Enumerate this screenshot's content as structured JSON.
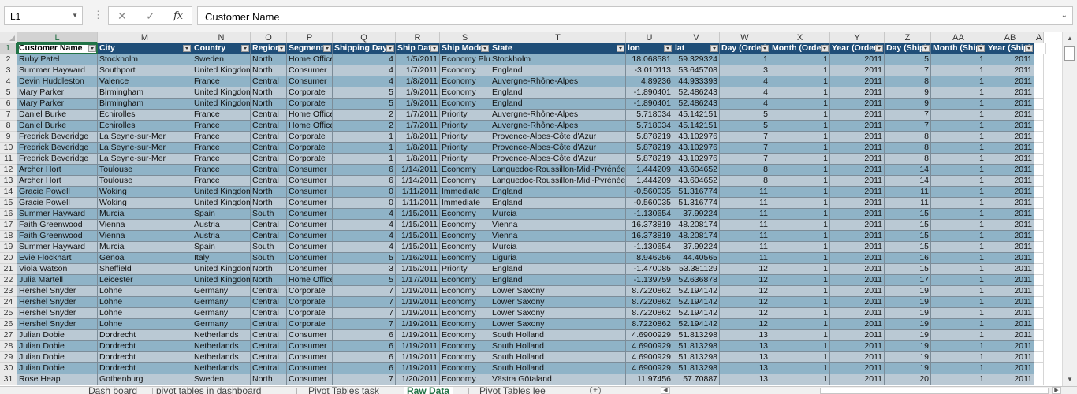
{
  "formula_bar": {
    "name_box": "L1",
    "cancel_icon": "✕",
    "confirm_icon": "✓",
    "fx_label": "fx",
    "content": "Customer Name"
  },
  "columns": [
    "L",
    "M",
    "N",
    "O",
    "P",
    "Q",
    "R",
    "S",
    "T",
    "U",
    "V",
    "W",
    "X",
    "Y",
    "Z",
    "AA",
    "AB",
    "A"
  ],
  "headers": [
    "Customer Name",
    "City",
    "Country",
    "Region",
    "Segment",
    "Shipping Days",
    "Ship Date",
    "Ship Mode",
    "State",
    "lon",
    "lat",
    "Day (Order)",
    "Month (Order)",
    "Year (Order)",
    "Day (Ship)",
    "Month (Ship)",
    "Year (Ship)"
  ],
  "rows": [
    {
      "n": "2",
      "c": [
        "Ruby Patel",
        "Stockholm",
        "Sweden",
        "North",
        "Home Office",
        "4",
        "1/5/2011",
        "Economy Plus",
        "Stockholm",
        "18.068581",
        "59.329324",
        "1",
        "1",
        "2011",
        "5",
        "1",
        "2011"
      ]
    },
    {
      "n": "3",
      "c": [
        "Summer Hayward",
        "Southport",
        "United Kingdom",
        "North",
        "Consumer",
        "4",
        "1/7/2011",
        "Economy",
        "England",
        "-3.010113",
        "53.645708",
        "3",
        "1",
        "2011",
        "7",
        "1",
        "2011"
      ]
    },
    {
      "n": "4",
      "c": [
        "Devin Huddleston",
        "Valence",
        "France",
        "Central",
        "Consumer",
        "4",
        "1/8/2011",
        "Economy",
        "Auvergne-Rhône-Alpes",
        "4.89236",
        "44.933393",
        "4",
        "1",
        "2011",
        "8",
        "1",
        "2011"
      ]
    },
    {
      "n": "5",
      "c": [
        "Mary Parker",
        "Birmingham",
        "United Kingdom",
        "North",
        "Corporate",
        "5",
        "1/9/2011",
        "Economy",
        "England",
        "-1.890401",
        "52.486243",
        "4",
        "1",
        "2011",
        "9",
        "1",
        "2011"
      ]
    },
    {
      "n": "6",
      "c": [
        "Mary Parker",
        "Birmingham",
        "United Kingdom",
        "North",
        "Corporate",
        "5",
        "1/9/2011",
        "Economy",
        "England",
        "-1.890401",
        "52.486243",
        "4",
        "1",
        "2011",
        "9",
        "1",
        "2011"
      ]
    },
    {
      "n": "7",
      "c": [
        "Daniel Burke",
        "Echirolles",
        "France",
        "Central",
        "Home Office",
        "2",
        "1/7/2011",
        "Priority",
        "Auvergne-Rhône-Alpes",
        "5.718034",
        "45.142151",
        "5",
        "1",
        "2011",
        "7",
        "1",
        "2011"
      ]
    },
    {
      "n": "8",
      "c": [
        "Daniel Burke",
        "Echirolles",
        "France",
        "Central",
        "Home Office",
        "2",
        "1/7/2011",
        "Priority",
        "Auvergne-Rhône-Alpes",
        "5.718034",
        "45.142151",
        "5",
        "1",
        "2011",
        "7",
        "1",
        "2011"
      ]
    },
    {
      "n": "9",
      "c": [
        "Fredrick Beveridge",
        "La Seyne-sur-Mer",
        "France",
        "Central",
        "Corporate",
        "1",
        "1/8/2011",
        "Priority",
        "Provence-Alpes-Côte d'Azur",
        "5.878219",
        "43.102976",
        "7",
        "1",
        "2011",
        "8",
        "1",
        "2011"
      ]
    },
    {
      "n": "10",
      "c": [
        "Fredrick Beveridge",
        "La Seyne-sur-Mer",
        "France",
        "Central",
        "Corporate",
        "1",
        "1/8/2011",
        "Priority",
        "Provence-Alpes-Côte d'Azur",
        "5.878219",
        "43.102976",
        "7",
        "1",
        "2011",
        "8",
        "1",
        "2011"
      ]
    },
    {
      "n": "11",
      "c": [
        "Fredrick Beveridge",
        "La Seyne-sur-Mer",
        "France",
        "Central",
        "Corporate",
        "1",
        "1/8/2011",
        "Priority",
        "Provence-Alpes-Côte d'Azur",
        "5.878219",
        "43.102976",
        "7",
        "1",
        "2011",
        "8",
        "1",
        "2011"
      ]
    },
    {
      "n": "12",
      "c": [
        "Archer Hort",
        "Toulouse",
        "France",
        "Central",
        "Consumer",
        "6",
        "1/14/2011",
        "Economy",
        "Languedoc-Roussillon-Midi-Pyrénées",
        "1.444209",
        "43.604652",
        "8",
        "1",
        "2011",
        "14",
        "1",
        "2011"
      ]
    },
    {
      "n": "13",
      "c": [
        "Archer Hort",
        "Toulouse",
        "France",
        "Central",
        "Consumer",
        "6",
        "1/14/2011",
        "Economy",
        "Languedoc-Roussillon-Midi-Pyrénées",
        "1.444209",
        "43.604652",
        "8",
        "1",
        "2011",
        "14",
        "1",
        "2011"
      ]
    },
    {
      "n": "14",
      "c": [
        "Gracie Powell",
        "Woking",
        "United Kingdom",
        "North",
        "Consumer",
        "0",
        "1/11/2011",
        "Immediate",
        "England",
        "-0.560035",
        "51.316774",
        "11",
        "1",
        "2011",
        "11",
        "1",
        "2011"
      ]
    },
    {
      "n": "15",
      "c": [
        "Gracie Powell",
        "Woking",
        "United Kingdom",
        "North",
        "Consumer",
        "0",
        "1/11/2011",
        "Immediate",
        "England",
        "-0.560035",
        "51.316774",
        "11",
        "1",
        "2011",
        "11",
        "1",
        "2011"
      ]
    },
    {
      "n": "16",
      "c": [
        "Summer Hayward",
        "Murcia",
        "Spain",
        "South",
        "Consumer",
        "4",
        "1/15/2011",
        "Economy",
        "Murcia",
        "-1.130654",
        "37.99224",
        "11",
        "1",
        "2011",
        "15",
        "1",
        "2011"
      ]
    },
    {
      "n": "17",
      "c": [
        "Faith Greenwood",
        "Vienna",
        "Austria",
        "Central",
        "Consumer",
        "4",
        "1/15/2011",
        "Economy",
        "Vienna",
        "16.373819",
        "48.208174",
        "11",
        "1",
        "2011",
        "15",
        "1",
        "2011"
      ]
    },
    {
      "n": "18",
      "c": [
        "Faith Greenwood",
        "Vienna",
        "Austria",
        "Central",
        "Consumer",
        "4",
        "1/15/2011",
        "Economy",
        "Vienna",
        "16.373819",
        "48.208174",
        "11",
        "1",
        "2011",
        "15",
        "1",
        "2011"
      ]
    },
    {
      "n": "19",
      "c": [
        "Summer Hayward",
        "Murcia",
        "Spain",
        "South",
        "Consumer",
        "4",
        "1/15/2011",
        "Economy",
        "Murcia",
        "-1.130654",
        "37.99224",
        "11",
        "1",
        "2011",
        "15",
        "1",
        "2011"
      ]
    },
    {
      "n": "20",
      "c": [
        "Evie Flockhart",
        "Genoa",
        "Italy",
        "South",
        "Consumer",
        "5",
        "1/16/2011",
        "Economy",
        "Liguria",
        "8.946256",
        "44.40565",
        "11",
        "1",
        "2011",
        "16",
        "1",
        "2011"
      ]
    },
    {
      "n": "21",
      "c": [
        "Viola Watson",
        "Sheffield",
        "United Kingdom",
        "North",
        "Consumer",
        "3",
        "1/15/2011",
        "Priority",
        "England",
        "-1.470085",
        "53.381129",
        "12",
        "1",
        "2011",
        "15",
        "1",
        "2011"
      ]
    },
    {
      "n": "22",
      "c": [
        "Julia Martell",
        "Leicester",
        "United Kingdom",
        "North",
        "Home Office",
        "5",
        "1/17/2011",
        "Economy",
        "England",
        "-1.139759",
        "52.636878",
        "12",
        "1",
        "2011",
        "17",
        "1",
        "2011"
      ]
    },
    {
      "n": "23",
      "c": [
        "Hershel Snyder",
        "Lohne",
        "Germany",
        "Central",
        "Corporate",
        "7",
        "1/19/2011",
        "Economy",
        "Lower Saxony",
        "8.7220862",
        "52.194142",
        "12",
        "1",
        "2011",
        "19",
        "1",
        "2011"
      ]
    },
    {
      "n": "24",
      "c": [
        "Hershel Snyder",
        "Lohne",
        "Germany",
        "Central",
        "Corporate",
        "7",
        "1/19/2011",
        "Economy",
        "Lower Saxony",
        "8.7220862",
        "52.194142",
        "12",
        "1",
        "2011",
        "19",
        "1",
        "2011"
      ]
    },
    {
      "n": "25",
      "c": [
        "Hershel Snyder",
        "Lohne",
        "Germany",
        "Central",
        "Corporate",
        "7",
        "1/19/2011",
        "Economy",
        "Lower Saxony",
        "8.7220862",
        "52.194142",
        "12",
        "1",
        "2011",
        "19",
        "1",
        "2011"
      ]
    },
    {
      "n": "26",
      "c": [
        "Hershel Snyder",
        "Lohne",
        "Germany",
        "Central",
        "Corporate",
        "7",
        "1/19/2011",
        "Economy",
        "Lower Saxony",
        "8.7220862",
        "52.194142",
        "12",
        "1",
        "2011",
        "19",
        "1",
        "2011"
      ]
    },
    {
      "n": "27",
      "c": [
        "Julian Dobie",
        "Dordrecht",
        "Netherlands",
        "Central",
        "Consumer",
        "6",
        "1/19/2011",
        "Economy",
        "South Holland",
        "4.6900929",
        "51.813298",
        "13",
        "1",
        "2011",
        "19",
        "1",
        "2011"
      ]
    },
    {
      "n": "28",
      "c": [
        "Julian Dobie",
        "Dordrecht",
        "Netherlands",
        "Central",
        "Consumer",
        "6",
        "1/19/2011",
        "Economy",
        "South Holland",
        "4.6900929",
        "51.813298",
        "13",
        "1",
        "2011",
        "19",
        "1",
        "2011"
      ]
    },
    {
      "n": "29",
      "c": [
        "Julian Dobie",
        "Dordrecht",
        "Netherlands",
        "Central",
        "Consumer",
        "6",
        "1/19/2011",
        "Economy",
        "South Holland",
        "4.6900929",
        "51.813298",
        "13",
        "1",
        "2011",
        "19",
        "1",
        "2011"
      ]
    },
    {
      "n": "30",
      "c": [
        "Julian Dobie",
        "Dordrecht",
        "Netherlands",
        "Central",
        "Consumer",
        "6",
        "1/19/2011",
        "Economy",
        "South Holland",
        "4.6900929",
        "51.813298",
        "13",
        "1",
        "2011",
        "19",
        "1",
        "2011"
      ]
    },
    {
      "n": "31",
      "c": [
        "Rose Heap",
        "Gothenburg",
        "Sweden",
        "North",
        "Consumer",
        "7",
        "1/20/2011",
        "Economy",
        "Västra Götaland",
        "11.97456",
        "57.70887",
        "13",
        "1",
        "2011",
        "20",
        "1",
        "2011"
      ]
    }
  ],
  "sheet_tabs": [
    "Dash board",
    "pivot tables in dashboard",
    "Pivot Tables task",
    "Raw Data",
    "Pivot Tables lee"
  ],
  "active_tab": "Raw Data",
  "colors": {
    "header_fill": "#1f4e78",
    "band_dark": "#8fb3c7",
    "band_light": "#bac9d4",
    "accent": "#217346"
  }
}
